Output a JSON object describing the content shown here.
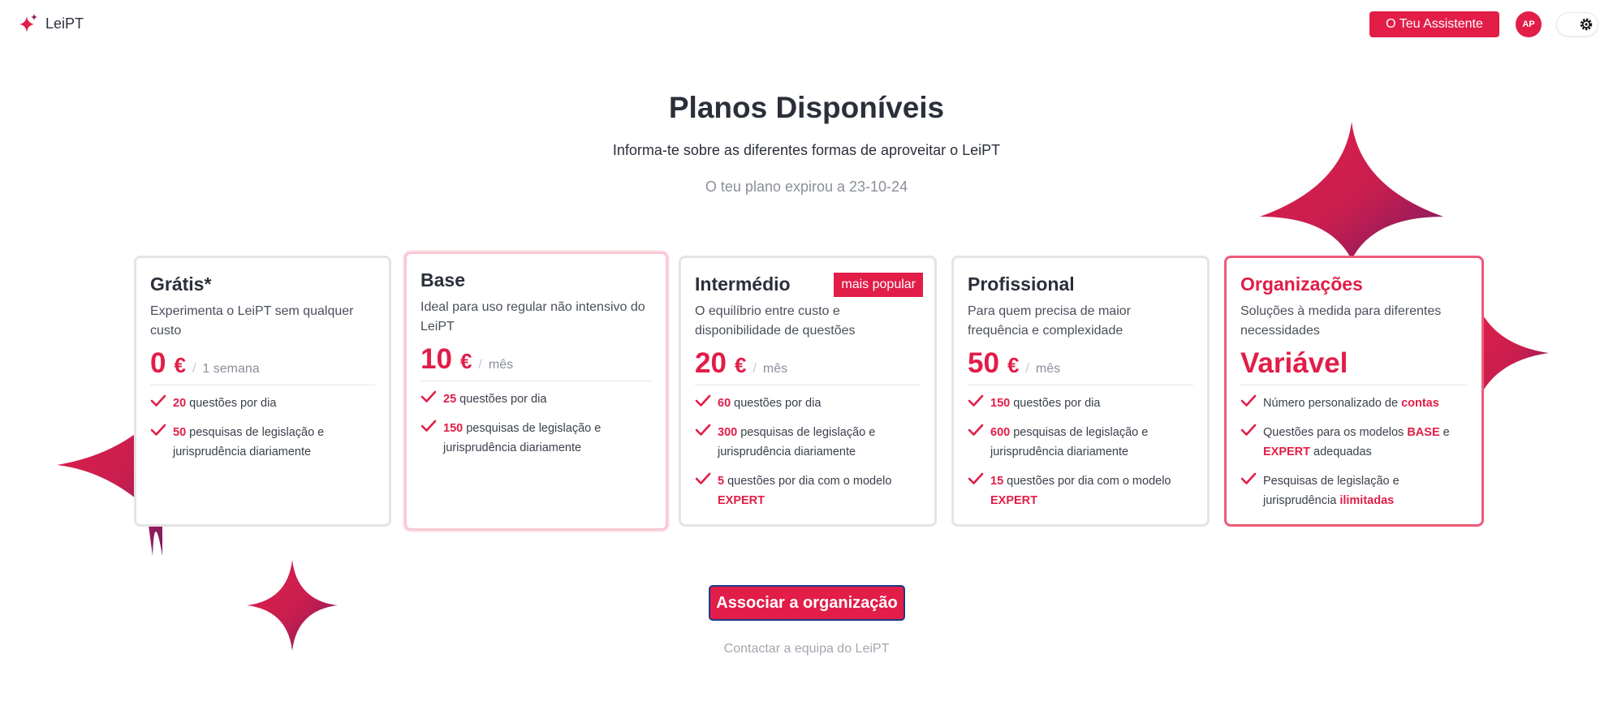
{
  "colors": {
    "accent": "#e11d48",
    "accent_dark": "#8b1a5e",
    "border": "#e4e4e4"
  },
  "header": {
    "logo_text": "LeiPT",
    "assistant_button": "O Teu Assistente",
    "avatar_initials": "AP",
    "theme_toggle_icon": "gear-icon"
  },
  "hero": {
    "title": "Planos Disponíveis",
    "subtitle": "Informa-te sobre as diferentes formas de aproveitar o LeiPT",
    "expired_notice": "O teu plano expirou a 23-10-24"
  },
  "plans": [
    {
      "title": "Grátis*",
      "desc": "Experimenta o LeiPT sem qualquer custo",
      "price": "0",
      "currency": "€",
      "period": "1 semana",
      "features": [
        {
          "hl": "20",
          "text": " questões por dia"
        },
        {
          "hl": "50",
          "text": " pesquisas de legislação e jurisprudência diariamente"
        }
      ]
    },
    {
      "title": "Base",
      "desc": "Ideal para uso regular não intensivo do LeiPT",
      "price": "10",
      "currency": "€",
      "period": "mês",
      "features": [
        {
          "hl": "25",
          "text": " questões por dia"
        },
        {
          "hl": "150",
          "text": " pesquisas de legislação e jurisprudência diariamente"
        }
      ]
    },
    {
      "title": "Intermédio",
      "badge": "mais popular",
      "desc": "O equilíbrio entre custo e disponibilidade de questões",
      "price": "20",
      "currency": "€",
      "period": "mês",
      "features": [
        {
          "hl": "60",
          "text": " questões por dia"
        },
        {
          "hl": "300",
          "text": " pesquisas de legislação e jurisprudência diariamente"
        },
        {
          "hl": "5",
          "text": " questões por dia com o modelo ",
          "tail": "EXPERT"
        }
      ]
    },
    {
      "title": "Profissional",
      "desc": "Para quem precisa de maior frequência e complexidade",
      "price": "50",
      "currency": "€",
      "period": "mês",
      "features": [
        {
          "hl": "150",
          "text": " questões por dia"
        },
        {
          "hl": "600",
          "text": " pesquisas de legislação e jurisprudência diariamente"
        },
        {
          "hl": "15",
          "text": " questões por dia com o modelo ",
          "tail": "EXPERT"
        }
      ]
    },
    {
      "title": "Organizações",
      "desc": "Soluções à medida para diferentes necessidades",
      "price_text": "Variável",
      "features": [
        {
          "pre": "Número personalizado de ",
          "hl": "contas"
        },
        {
          "pre": "Questões para os modelos ",
          "hl": "BASE",
          "mid": " e ",
          "hl2": "EXPERT",
          "post": " adequadas"
        },
        {
          "pre": "Pesquisas de legislação e jurisprudência ",
          "hl": "ilimitadas"
        }
      ]
    }
  ],
  "cta": {
    "join_button": "Associar a organização",
    "contact_link": "Contactar a equipa do LeiPT"
  }
}
